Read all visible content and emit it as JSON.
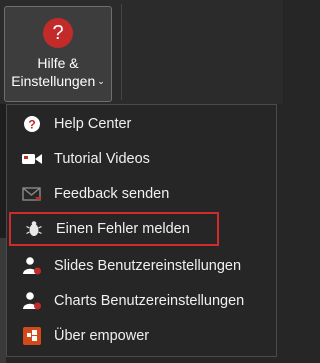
{
  "ribbon": {
    "help_button": {
      "line1": "Hilfe &",
      "line2": "Einstellungen",
      "chevron": "⌄",
      "icon_glyph": "?",
      "icon": "question-circle-icon"
    }
  },
  "menu": {
    "items": [
      {
        "label": "Help Center",
        "icon": "question-circle-icon"
      },
      {
        "label": "Tutorial Videos",
        "icon": "video-camera-icon"
      },
      {
        "label": "Feedback senden",
        "icon": "envelope-icon"
      },
      {
        "label": "Einen Fehler melden",
        "icon": "bug-icon",
        "highlighted": true
      },
      {
        "label": "Slides Benutzereinstellungen",
        "icon": "user-settings-icon"
      },
      {
        "label": "Charts Benutzereinstellungen",
        "icon": "user-settings-icon"
      },
      {
        "label": "Über empower",
        "icon": "empower-logo-icon"
      }
    ]
  },
  "colors": {
    "accent_red": "#c32b2b",
    "highlight_border": "#d12a2a",
    "menu_bg": "#262626",
    "ribbon_bg": "#2b2b2b"
  }
}
